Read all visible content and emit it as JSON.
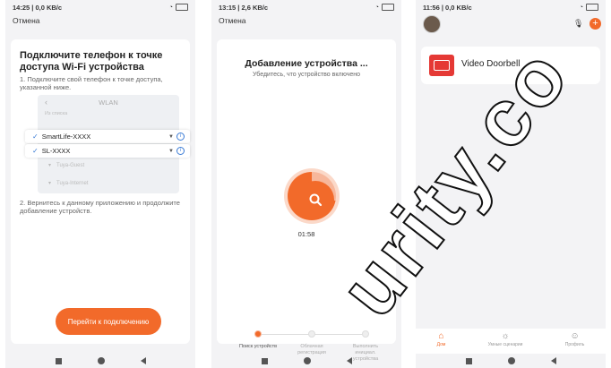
{
  "screen1": {
    "status": {
      "time": "14:25 | 0,0 KB/c",
      "battery": ""
    },
    "cancel": "Отмена",
    "title": "Подключите телефон к точке доступа Wi-Fi устройства",
    "step1": "1. Подключите свой телефон к точке доступа, указанной ниже.",
    "wlan": {
      "header": "WLAN",
      "sub": "Из списка",
      "networks": [
        "SmartLife-XXXX",
        "SL-XXXX"
      ],
      "faded": [
        "Tuya-Guest",
        "Tuya-Internet"
      ]
    },
    "step2": "2. Вернитесь к данному приложению и продолжите добавление устройств.",
    "button": "Перейти к подключению"
  },
  "screen2": {
    "status": {
      "time": "13:15 | 2,6 KB/c"
    },
    "cancel": "Отмена",
    "title": "Добавление устройства ...",
    "subtitle": "Убедитесь, что устройство включено",
    "timer": "01:58",
    "steps": [
      "Поиск устройств",
      "Облачная регистрация",
      "Выполнить инициал. устройства"
    ],
    "search_progress": 0.72
  },
  "screen3": {
    "status": {
      "time": "11:56 | 0,0 KB/c"
    },
    "device": {
      "name": "Video Doorbell"
    },
    "tabs": [
      "Дом",
      "Умные сценарии",
      "Профиль"
    ]
  },
  "watermark": "urity.co",
  "colors": {
    "accent": "#f26a2a",
    "link": "#3a7bd5",
    "device": "#e53935"
  }
}
